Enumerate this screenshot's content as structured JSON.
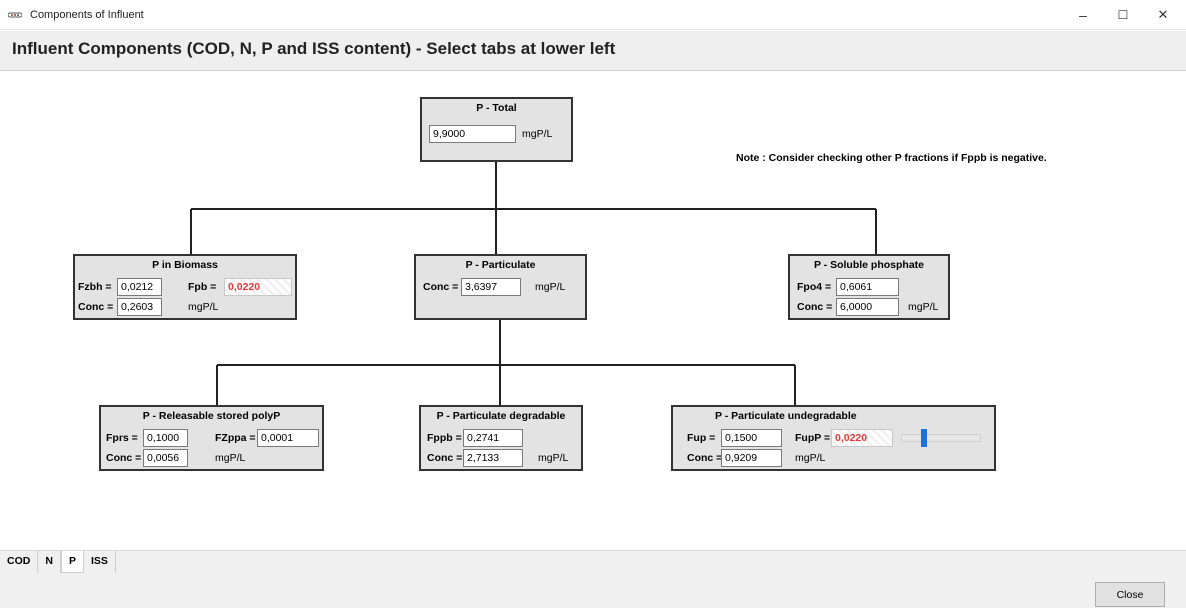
{
  "window": {
    "title": "Components of Influent",
    "minimize": "–",
    "maximize": "☐",
    "close": "✕"
  },
  "header": {
    "title": "Influent Components (COD, N, P and ISS content) - Select tabs at lower left"
  },
  "note": "Note : Consider checking other P fractions if Fppb is negative.",
  "boxes": {
    "total": {
      "title": "P - Total",
      "value": "9,9000",
      "unit": "mgP/L"
    },
    "biomass": {
      "title": "P in Biomass",
      "fzbh_label": "Fzbh =",
      "fzbh": "0,0212",
      "fpb_label": "Fpb =",
      "fpb": "0,0220",
      "conc_label": "Conc =",
      "conc": "0,2603",
      "unit": "mgP/L"
    },
    "particulate": {
      "title": "P - Particulate",
      "conc_label": "Conc =",
      "conc": "3,6397",
      "unit": "mgP/L"
    },
    "soluble": {
      "title": "P - Soluble phosphate",
      "fpo4_label": "Fpo4 =",
      "fpo4": "0,6061",
      "conc_label": "Conc =",
      "conc": "6,0000",
      "unit": "mgP/L"
    },
    "polyp": {
      "title": "P - Releasable stored polyP",
      "fprs_label": "Fprs =",
      "fprs": "0,1000",
      "fzppa_label": "FZppa =",
      "fzppa": "0,0001",
      "conc_label": "Conc =",
      "conc": "0,0056",
      "unit": "mgP/L"
    },
    "degradable": {
      "title": "P - Particulate degradable",
      "fppb_label": "Fppb =",
      "fppb": "0,2741",
      "conc_label": "Conc =",
      "conc": "2,7133",
      "unit": "mgP/L"
    },
    "undegradable": {
      "title": "P - Particulate undegradable",
      "fup_label": "Fup =",
      "fup": "0,1500",
      "fupp_label": "FupP =",
      "fupp": "0,0220",
      "conc_label": "Conc =",
      "conc": "0,9209",
      "unit": "mgP/L",
      "slider_level": 0.25
    }
  },
  "tabs": [
    {
      "label": "COD"
    },
    {
      "label": "N"
    },
    {
      "label": "P",
      "active": true
    },
    {
      "label": "ISS"
    }
  ],
  "footer": {
    "close_label": "Close"
  },
  "colors": {
    "calc_text": "#e23c3c",
    "slider_thumb": "#1a73d9",
    "box_bg": "#e3e3e3"
  }
}
